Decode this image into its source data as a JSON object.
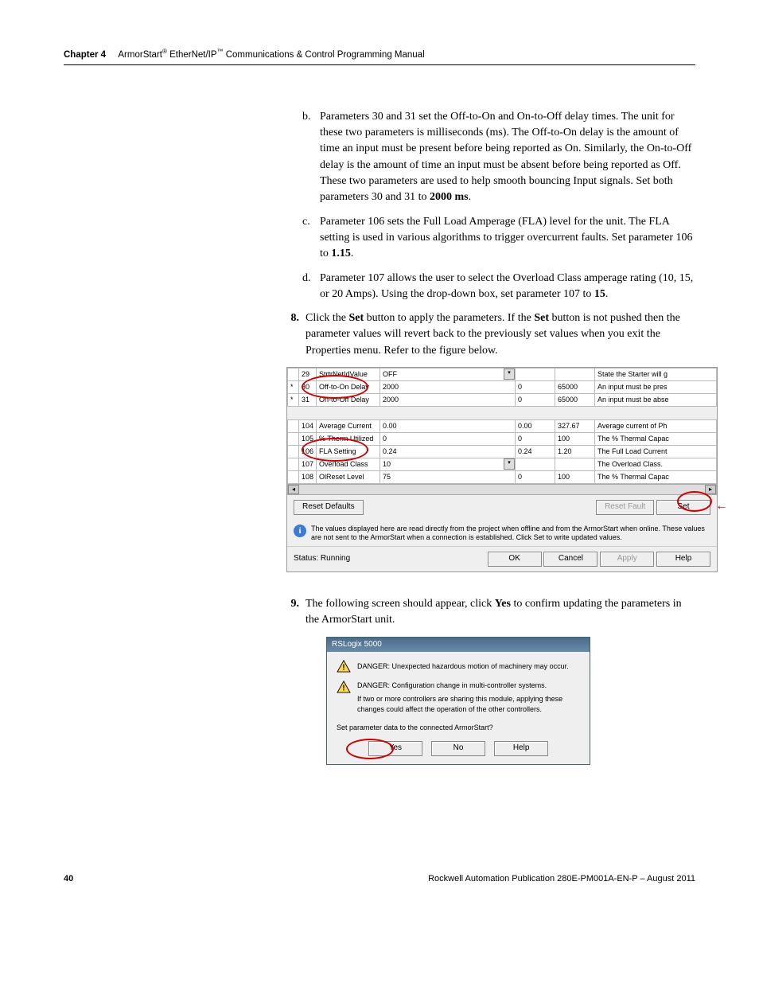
{
  "header": {
    "chapter": "Chapter 4",
    "title_html": "ArmorStart",
    "title_reg1": "®",
    "title_mid": " EtherNet/IP",
    "title_reg2": "™",
    "title_tail": " Communications & Control Programming Manual"
  },
  "items": {
    "b": "Parameters 30 and 31 set the Off-to-On and On-to-Off delay times. The unit for these two parameters is milliseconds (ms). The Off-to-On delay is the amount of time an input must be present before being reported as On. Similarly, the On-to-Off delay is the amount of time an input must be absent before being reported as Off. These two parameters are used to help smooth bouncing Input signals. Set both parameters 30 and 31 to ",
    "b_bold": "2000 ms",
    "c": "Parameter 106 sets the Full Load Amperage (FLA) level for the unit. The FLA setting is used in various algorithms to trigger overcurrent faults. Set parameter 106 to ",
    "c_bold": "1.15",
    "d": "Parameter 107 allows the user to select the Overload Class amperage rating (10, 15, or 20 Amps). Using the drop-down box, set parameter 107 to ",
    "d_bold": "15",
    "s8_a": "Click the ",
    "s8_b": "Set",
    "s8_c": " button to apply the parameters. If the ",
    "s8_d": "Set",
    "s8_e": " button is not pushed then the parameter values will revert back to the previously set values when you exit the Properties menu. Refer to the figure below.",
    "s9_a": "The following screen should appear, click ",
    "s9_b": "Yes",
    "s9_c": " to confirm updating the parameters in the ArmorStart unit."
  },
  "shot1": {
    "top_rows": [
      {
        "star": "",
        "id": "29",
        "name": "StrtrNetIdValue",
        "val": "OFF",
        "drop": true,
        "min": "",
        "max": "",
        "desc": "State the Starter will g"
      },
      {
        "star": "*",
        "id": "30",
        "name": "Off-to-On Delay",
        "val": "2000",
        "drop": false,
        "min": "0",
        "max": "65000",
        "desc": "An input must be pres"
      },
      {
        "star": "*",
        "id": "31",
        "name": "On-to-Off Delay",
        "val": "2000",
        "drop": false,
        "min": "0",
        "max": "65000",
        "desc": "An input must be abse"
      }
    ],
    "mid_rows": [
      {
        "id": "104",
        "name": "Average Current",
        "val": "0.00",
        "min": "0.00",
        "max": "327.67",
        "desc": "Average current of Ph"
      },
      {
        "id": "105",
        "name": "% Therm Utilized",
        "val": "0",
        "min": "0",
        "max": "100",
        "desc": "The % Thermal Capac"
      },
      {
        "id": "106",
        "name": "FLA Setting",
        "val": "0.24",
        "min": "0.24",
        "max": "1.20",
        "desc": "The Full Load Current"
      },
      {
        "id": "107",
        "name": "Overload Class",
        "val": "10",
        "drop": true,
        "min": "",
        "max": "",
        "desc": "The Overload Class."
      },
      {
        "id": "108",
        "name": "OlReset Level",
        "val": "75",
        "min": "0",
        "max": "100",
        "desc": "The % Thermal Capac"
      }
    ],
    "reset_defaults": "Reset Defaults",
    "reset_fault": "Reset Fault",
    "set": "Set",
    "info_text": "The values displayed here are read directly from the project when offline and from the ArmorStart when online. These values are not sent to the ArmorStart when a connection is established.  Click Set to write updated values.",
    "status_label": "Status:  Running",
    "ok": "OK",
    "cancel": "Cancel",
    "apply": "Apply",
    "help": "Help"
  },
  "dialog": {
    "title": "RSLogix 5000",
    "danger1": "DANGER:  Unexpected hazardous motion of machinery may occur.",
    "danger2": "DANGER:  Configuration change in multi-controller systems.",
    "sub2": "If two or more controllers are sharing this module, applying these changes could affect the operation of the other controllers.",
    "question": "Set parameter data to the connected ArmorStart?",
    "yes": "Yes",
    "no": "No",
    "help": "Help"
  },
  "footer": {
    "page": "40",
    "pub": "Rockwell Automation Publication 280E-PM001A-EN-P – August 2011"
  }
}
